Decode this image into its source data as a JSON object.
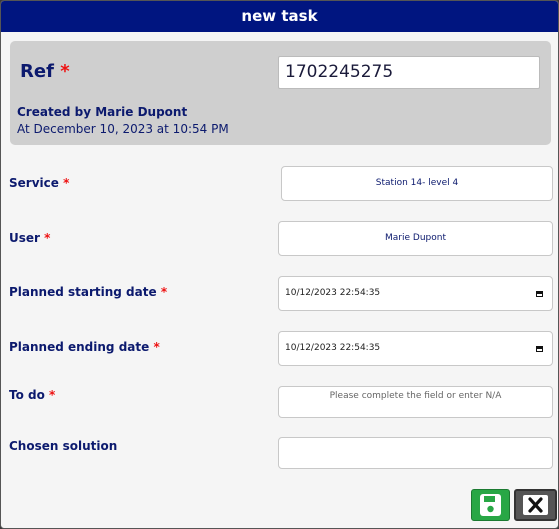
{
  "dialog": {
    "title": "new task"
  },
  "header": {
    "ref_label": "Ref",
    "required_mark": "*",
    "ref_value": "1702245275",
    "created_by": "Created by Marie Dupont",
    "created_at": "At December 10, 2023 at 10:54 PM"
  },
  "fields": {
    "service": {
      "label": "Service",
      "value": "Station 14- level 4"
    },
    "user": {
      "label": "User",
      "value": "Marie Dupont"
    },
    "planned_start": {
      "label": "Planned starting date",
      "value": "10/12/2023 22:54:35"
    },
    "planned_end": {
      "label": "Planned ending date",
      "value": "10/12/2023 22:54:35"
    },
    "todo": {
      "label": "To do",
      "placeholder": "Please complete the field or enter N/A"
    },
    "chosen_solution": {
      "label": "Chosen solution",
      "value": ""
    }
  },
  "buttons": {
    "save_icon": "save-icon",
    "close_icon": "close-icon"
  },
  "colors": {
    "titlebar": "#001580",
    "label_text": "#0c1a6e",
    "required": "#ee1111",
    "save_button": "#28a745",
    "close_button": "#555555"
  }
}
